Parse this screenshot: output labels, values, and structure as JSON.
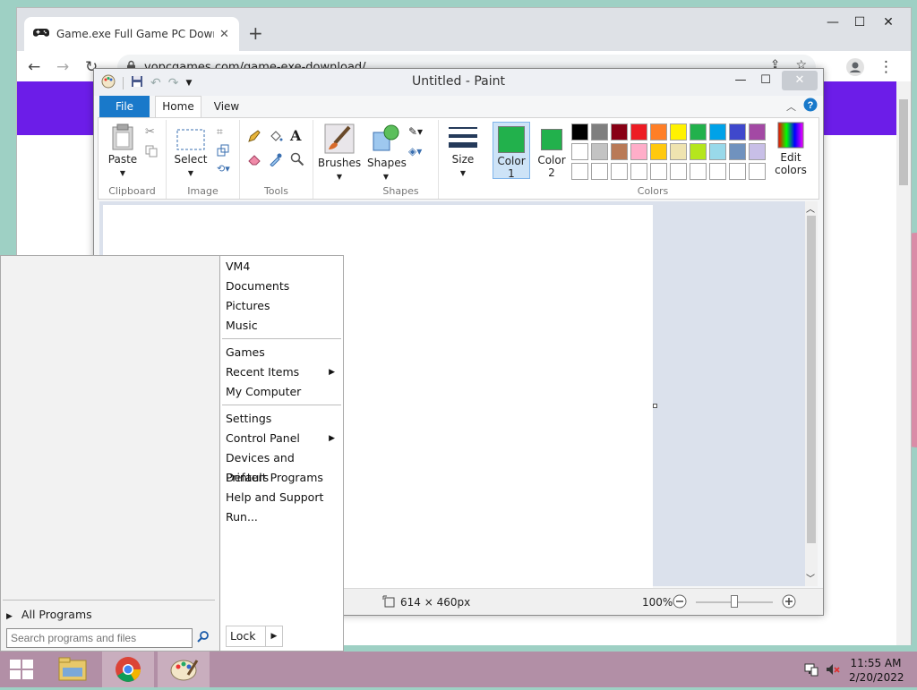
{
  "chrome": {
    "tab_title": "Game.exe Full Game PC Download",
    "url": "vopcgames.com/game-exe-download/"
  },
  "paint": {
    "title": "Untitled - Paint",
    "tabs": {
      "file": "File",
      "home": "Home",
      "view": "View"
    },
    "groups": {
      "clipboard": "Clipboard",
      "image": "Image",
      "tools": "Tools",
      "shapes": "Shapes",
      "colors": "Colors"
    },
    "buttons": {
      "paste": "Paste",
      "select": "Select",
      "brushes": "Brushes",
      "shapes": "Shapes",
      "size": "Size",
      "color1_a": "Color",
      "color1_b": "1",
      "color2_a": "Color",
      "color2_b": "2",
      "edit_colors_a": "Edit",
      "edit_colors_b": "colors"
    },
    "color1": "#22b14c",
    "color2": "#22b14c",
    "palette_row1": [
      "#000000",
      "#7f7f7f",
      "#880015",
      "#ed1c24",
      "#ff7f27",
      "#fff200",
      "#22b14c",
      "#00a2e8",
      "#3f48cc",
      "#a349a4"
    ],
    "palette_row2": [
      "#ffffff",
      "#c3c3c3",
      "#b97a57",
      "#ffaec9",
      "#ffc90e",
      "#efe4b0",
      "#b5e61d",
      "#99d9ea",
      "#7092be",
      "#c8bfe7"
    ],
    "status": {
      "canvas_size": "614 × 460px",
      "zoom": "100%"
    }
  },
  "startmenu": {
    "items_group1": [
      "VM4",
      "Documents",
      "Pictures",
      "Music"
    ],
    "items_group2": [
      "Games",
      "Recent Items",
      "My Computer"
    ],
    "items_group3": [
      "Settings",
      "Control Panel",
      "Devices and Printers",
      "Default Programs",
      "Help and Support",
      "Run..."
    ],
    "all_programs": "All Programs",
    "search_placeholder": "Search programs and files",
    "lock": "Lock"
  },
  "taskbar": {
    "time": "11:55 AM",
    "date": "2/20/2022"
  }
}
